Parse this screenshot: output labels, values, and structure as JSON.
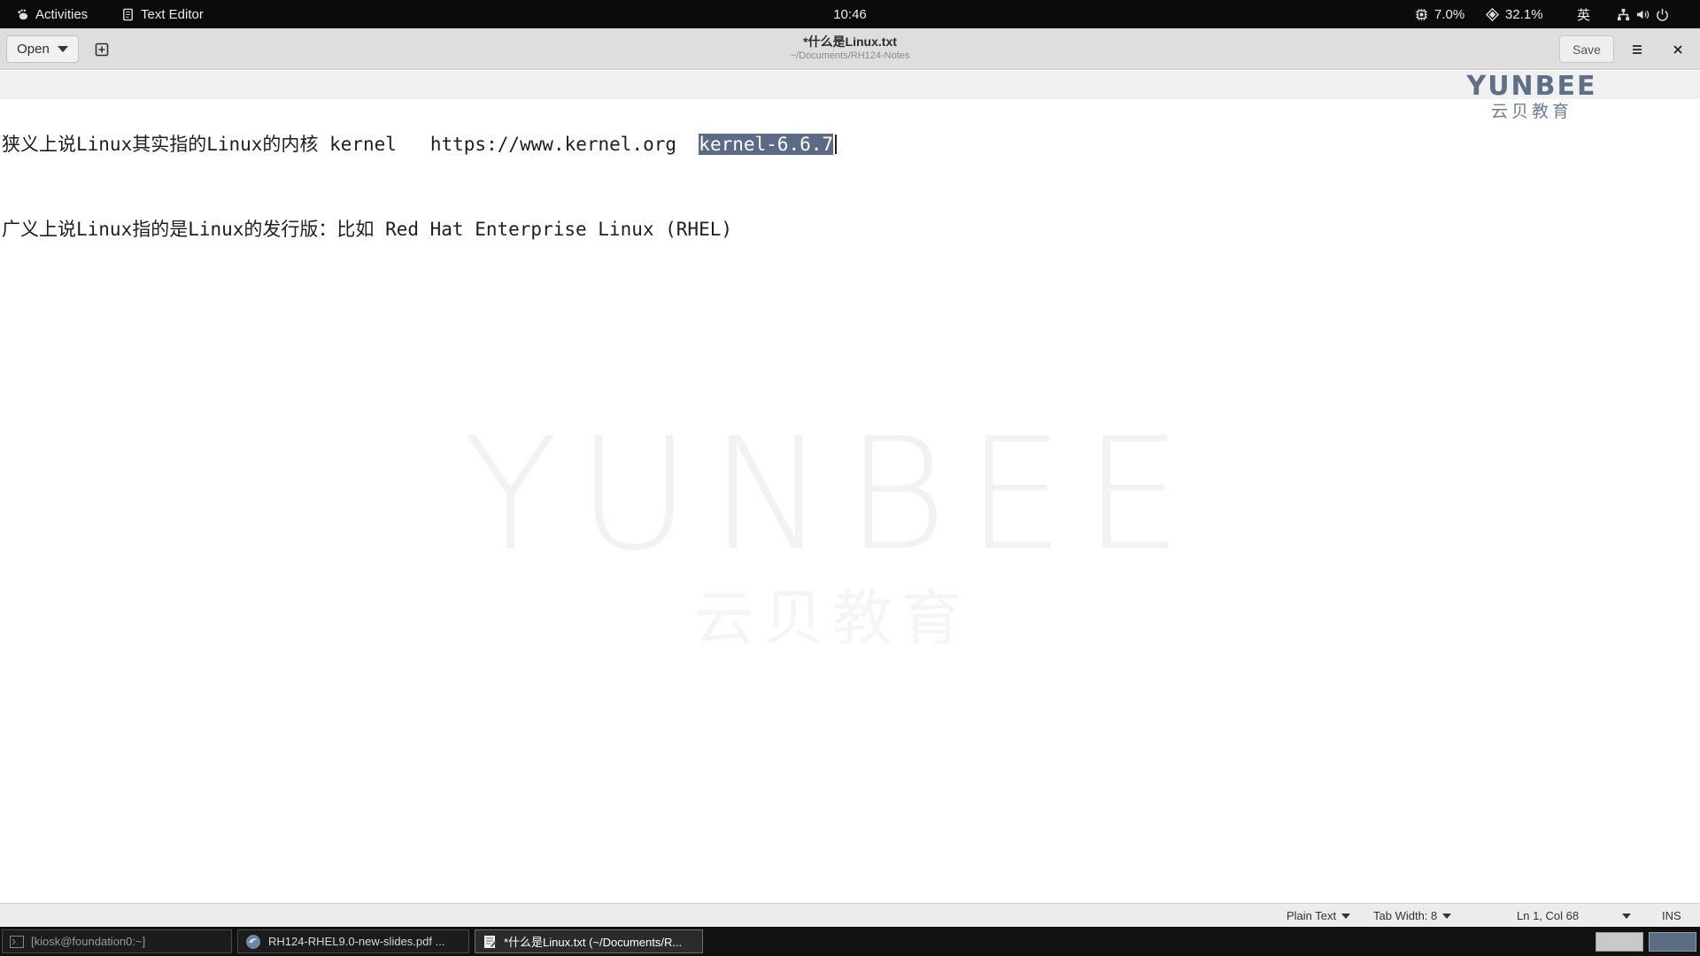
{
  "topbar": {
    "activities": "Activities",
    "app_name": "Text Editor",
    "time": "10:46",
    "cpu": "7.0%",
    "memory": "32.1%",
    "input_method": "英"
  },
  "header": {
    "open_label": "Open",
    "title": "*什么是Linux.txt",
    "path": "~/Documents/RH124-Notes",
    "save_label": "Save"
  },
  "editor": {
    "line1_before": "狭义上说Linux其实指的Linux的内核 kernel   https://www.kernel.org  ",
    "line1_selected": "kernel-6.6.7",
    "line2": "广义上说Linux指的是Linux的发行版：比如 Red Hat Enterprise Linux (RHEL)"
  },
  "watermark": {
    "corner_en": "YUNBEE",
    "corner_cn": "云贝教育",
    "center_en": "YUNBEE",
    "center_cn": "云贝教育"
  },
  "statusbar": {
    "language": "Plain Text",
    "tab_width": "Tab Width: 8",
    "position": "Ln 1, Col 68",
    "mode": "INS"
  },
  "taskbar": {
    "items": [
      {
        "label": "[kiosk@foundation0:~]"
      },
      {
        "label": "RH124-RHEL9.0-new-slides.pdf ..."
      },
      {
        "label": "*什么是Linux.txt (~/Documents/R..."
      }
    ]
  },
  "colors": {
    "selection": "#5b6b86",
    "topbar_bg": "#0b0b0b",
    "headerbar_bg": "#dedede",
    "watermark": "#5f6f86"
  }
}
